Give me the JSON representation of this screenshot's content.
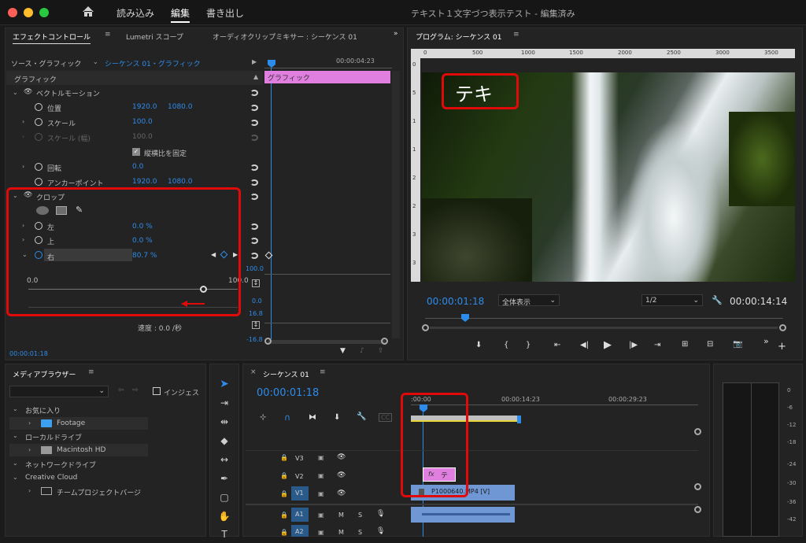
{
  "colors": {
    "accent": "#2d8ceb",
    "red": "#e00a0a",
    "clip_pink": "#e07fe0",
    "clip_blue": "#6e97d4"
  },
  "topbar": {
    "home_icon": "home-icon",
    "import_tab": "読み込み",
    "edit_tab": "編集",
    "export_tab": "書き出し",
    "title": "テキスト１文字づつ表示テスト - 編集済み"
  },
  "effect": {
    "tabs": [
      "エフェクトコントロール",
      "Lumetri スコープ",
      "オーディオクリップミキサー : シーケンス 01"
    ],
    "source": "ソース・グラフィック",
    "seq": "シーケンス 01・グラフィック",
    "timecode_ruler": "00:00:04:23",
    "clip_label": "グラフィック",
    "section": "グラフィック",
    "vector": "ベクトルモーション",
    "pos_label": "位置",
    "pos_x": "1920.0",
    "pos_y": "1080.0",
    "scale_label": "スケール",
    "scale_val": "100.0",
    "scalew_label": "スケール (幅)",
    "scalew_val": "100.0",
    "lock_label": "縦横比を固定",
    "rot_label": "回転",
    "rot_val": "0.0",
    "anchor_label": "アンカーポイント",
    "anchor_x": "1920.0",
    "anchor_y": "1080.0",
    "crop_label": "クロップ",
    "left_label": "左",
    "left_val": "0.0 %",
    "top_label": "上",
    "top_val": "0.0 %",
    "right_label": "右",
    "right_val": "80.7 %",
    "slider_min": "0.0",
    "slider_max": "100.0",
    "graph_vals": [
      "100.0",
      "0.0",
      "16.8",
      "-16.8"
    ],
    "speed": "速度 : 0.0 /秒",
    "timecode": "00:00:01:18"
  },
  "program": {
    "title": "プログラム: シーケンス 01",
    "ruler": [
      "0",
      "500",
      "1000",
      "1500",
      "2000",
      "2500",
      "3000",
      "3500"
    ],
    "vruler": [
      "0",
      "5",
      "1",
      "1",
      "2",
      "2",
      "3",
      "3"
    ],
    "overlay_text": "テキ",
    "timecode": "00:00:01:18",
    "fit": "全体表示",
    "res": "1/2",
    "duration": "00:00:14:14"
  },
  "media": {
    "title": "メディアブラウザー",
    "ingest": "インジェス",
    "tree": [
      "お気に入り",
      "Footage",
      "ローカルドライブ",
      "Macintosh HD",
      "ネットワークドライブ",
      "Creative Cloud",
      "チームプロジェクトバージ"
    ]
  },
  "sequence": {
    "tab": "シーケンス 01",
    "timecode": "00:00:01:18",
    "ruler": [
      ":00:00",
      "00:00:14:23",
      "00:00:29:23"
    ],
    "tracks": [
      "V3",
      "V2",
      "V1",
      "A1",
      "A2"
    ],
    "text_clip": "テ",
    "video_clip": "P1000640.MP4 [V]",
    "fx": "fx"
  },
  "meter": {
    "ticks": [
      "0",
      "-6",
      "-12",
      "-18",
      "-24",
      "-30",
      "-36",
      "-42"
    ]
  }
}
